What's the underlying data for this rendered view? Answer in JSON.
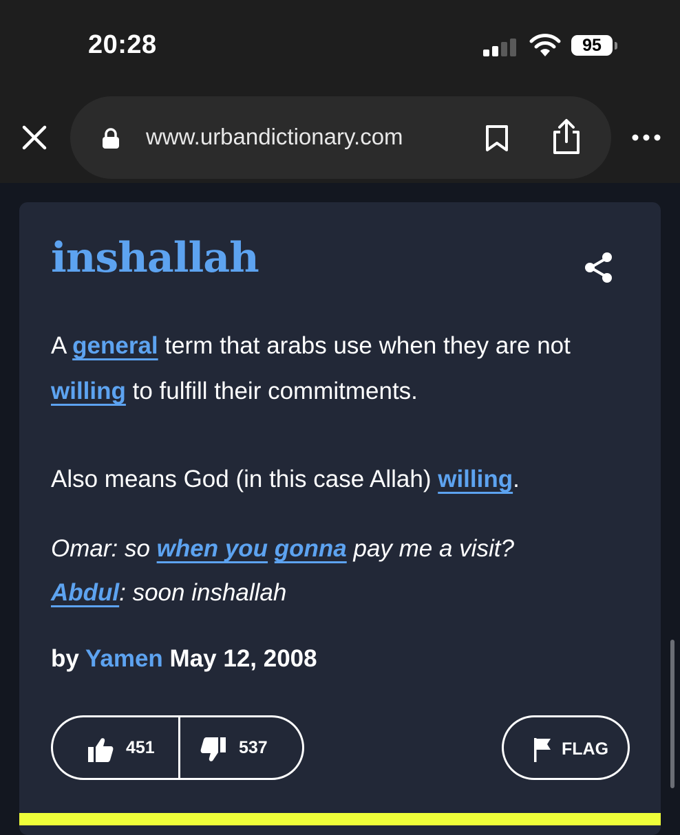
{
  "status_bar": {
    "time": "20:28",
    "battery": "95",
    "icons": [
      "signal-icon",
      "wifi-icon",
      "battery-icon"
    ]
  },
  "browser": {
    "url": "www.urbandictionary.com",
    "icons": [
      "close-icon",
      "lock-icon",
      "bookmark-icon",
      "share-icon",
      "more-icon"
    ]
  },
  "entry": {
    "word": "inshallah",
    "definition": {
      "p1": {
        "t1": "A ",
        "link1": "general",
        "t2": " term that arabs use when they are not ",
        "link2": "willing",
        "t3": " to fulfill their commitments."
      },
      "p2": {
        "t1": "Also means God (in this case Allah) ",
        "link1": "willing",
        "t2": "."
      }
    },
    "example": {
      "line1": {
        "t1": "Omar: so ",
        "link1": "when you",
        "t2": " ",
        "link2": "gonna",
        "t3": " pay me a visit?"
      },
      "line2": {
        "link1": "Abdul",
        "t1": ": soon inshallah"
      }
    },
    "byline": {
      "by": "by",
      "author": "Yamen",
      "date": "May 12, 2008"
    },
    "votes": {
      "up": "451",
      "down": "537"
    },
    "flag_label": "FLAG"
  },
  "colors": {
    "accent": "#5da3f0",
    "card": "#222837",
    "page": "#131720",
    "chrome": "#1e1e1e",
    "highlight": "#efff3a"
  }
}
